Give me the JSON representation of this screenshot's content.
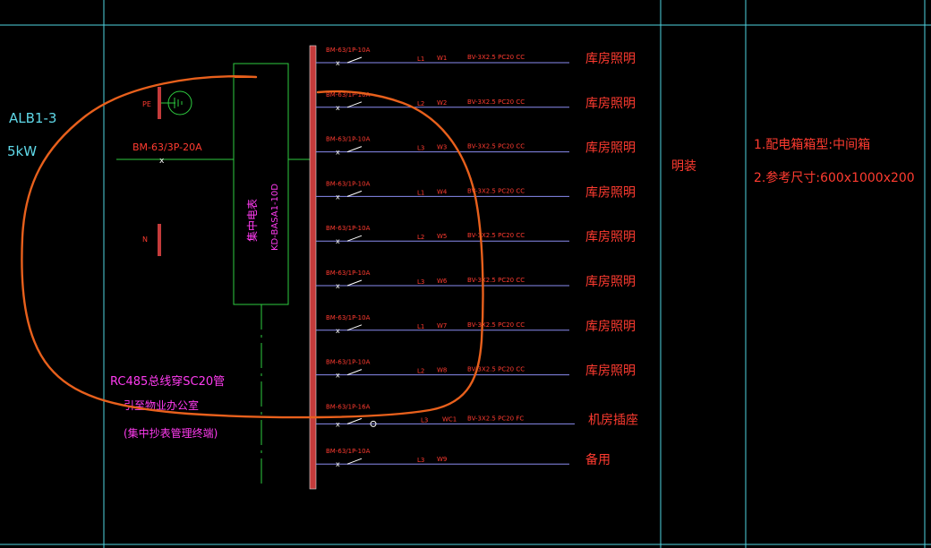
{
  "panel": {
    "id": "ALB1-3",
    "power": "5kW",
    "incoming_breaker": "BM-63/3P-20A",
    "pe_label": "PE",
    "n_label": "N",
    "meter_label": "集中电表",
    "meter_model": "KD-BASA1-10D",
    "bus_note_line1": "RC485总线穿SC20管",
    "bus_note_line2": "引至物业办公室",
    "bus_note_line3": "(集中抄表管理终端)"
  },
  "circuits": [
    {
      "breaker": "BM-63/1P-10A",
      "phase": "L1",
      "code": "W1",
      "cable": "BV-3X2.5  PC20  CC",
      "use": "库房照明"
    },
    {
      "breaker": "BM-63/1P-10A",
      "phase": "L2",
      "code": "W2",
      "cable": "BV-3X2.5  PC20  CC",
      "use": "库房照明"
    },
    {
      "breaker": "BM-63/1P-10A",
      "phase": "L3",
      "code": "W3",
      "cable": "BV-3X2.5  PC20  CC",
      "use": "库房照明"
    },
    {
      "breaker": "BM-63/1P-10A",
      "phase": "L1",
      "code": "W4",
      "cable": "BV-3X2.5  PC20  CC",
      "use": "库房照明"
    },
    {
      "breaker": "BM-63/1P-10A",
      "phase": "L2",
      "code": "W5",
      "cable": "BV-3X2.5  PC20  CC",
      "use": "库房照明"
    },
    {
      "breaker": "BM-63/1P-10A",
      "phase": "L3",
      "code": "W6",
      "cable": "BV-3X2.5  PC20  CC",
      "use": "库房照明"
    },
    {
      "breaker": "BM-63/1P-10A",
      "phase": "L1",
      "code": "W7",
      "cable": "BV-3X2.5  PC20  CC",
      "use": "库房照明"
    },
    {
      "breaker": "BM-63/1P-10A",
      "phase": "L2",
      "code": "W8",
      "cable": "BV-3X2.5  PC20  CC",
      "use": "库房照明"
    },
    {
      "breaker": "BM-63/1P-16A",
      "phase": "L3",
      "code": "WC1",
      "cable": "BV-3X2.5  PC20  FC",
      "use": "机房插座"
    },
    {
      "breaker": "BM-63/1P-10A",
      "phase": "L3",
      "code": "W9",
      "cable": "",
      "use": "备用"
    }
  ],
  "install": "明装",
  "notes": {
    "line1": "1.配电箱箱型:中间箱",
    "line2": "2.参考尺寸:600x1000x200"
  },
  "colors": {
    "frame": "#4fd3e0",
    "busbar": "#c43b3b",
    "feeder": "#8a8cf0",
    "meter_box": "#2ecc40",
    "red_text": "#ff3b30",
    "magenta_text": "#ff3bf0",
    "annotation": "#e8601c"
  }
}
